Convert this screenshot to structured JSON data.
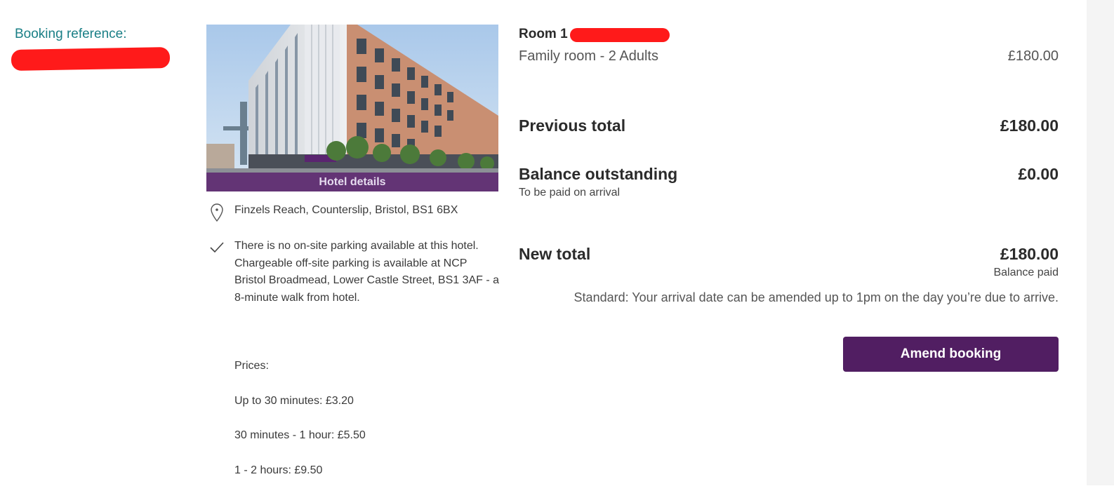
{
  "booking": {
    "reference_label": "Booking reference:"
  },
  "hotel": {
    "image_caption": "Hotel details",
    "address": "Finzels Reach, Counterslip, Bristol, BS1 6BX",
    "parking_note": "There is no on-site parking available at this hotel. Chargeable off-site parking is available at NCP Bristol Broadmead, Lower Castle Street, BS1 3AF - a 8-minute walk from hotel.",
    "prices_label": "Prices:",
    "prices": [
      "Up to 30 minutes: £3.20",
      "30 minutes - 1 hour: £5.50",
      "1 - 2 hours: £9.50"
    ]
  },
  "summary": {
    "room_title": "Room 1",
    "room_type": "Family room - 2 Adults",
    "room_price": "£180.00",
    "previous_total_label": "Previous total",
    "previous_total_value": "£180.00",
    "balance_label": "Balance outstanding",
    "balance_value": "£0.00",
    "balance_note": "To be paid on arrival",
    "new_total_label": "New total",
    "new_total_value": "£180.00",
    "new_total_note": "Balance paid",
    "policy": "Standard: Your arrival date can be amended up to 1pm on the day you’re due to arrive.",
    "amend_button": "Amend booking"
  },
  "colors": {
    "accent_purple": "#511e62",
    "link_teal": "#1a7f86",
    "redaction_red": "#ff1a1a"
  }
}
